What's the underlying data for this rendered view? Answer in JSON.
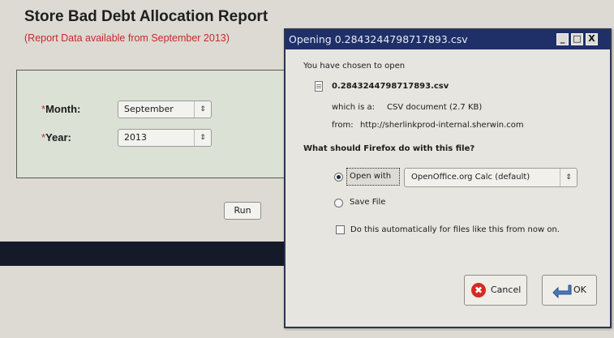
{
  "report": {
    "title": "Store Bad Debt Allocation Report",
    "subtitle": "(Report Data available from September 2013)",
    "month_label": "Month:",
    "month_value": "September",
    "year_label": "Year:",
    "year_value": "2013",
    "required_mark": "*",
    "run_label": "Run"
  },
  "dialog": {
    "title": "Opening 0.2843244798717893.csv",
    "chosen_text": "You have chosen to open",
    "filename": "0.2843244798717893.csv",
    "which_is_label": "which is a:",
    "which_is_value": "CSV document (2.7 KB)",
    "from_label": "from:",
    "from_value": "http://sherlinkprod-internal.sherwin.com",
    "question": "What should Firefox do with this file?",
    "open_with_label": "Open with",
    "open_with_app": "OpenOffice.org Calc (default)",
    "save_file_label": "Save File",
    "auto_text": "Do this automatically for files like this from now on.",
    "cancel_label": "Cancel",
    "ok_label": "OK",
    "minimize": "_",
    "maximize": "□",
    "close": "X"
  }
}
